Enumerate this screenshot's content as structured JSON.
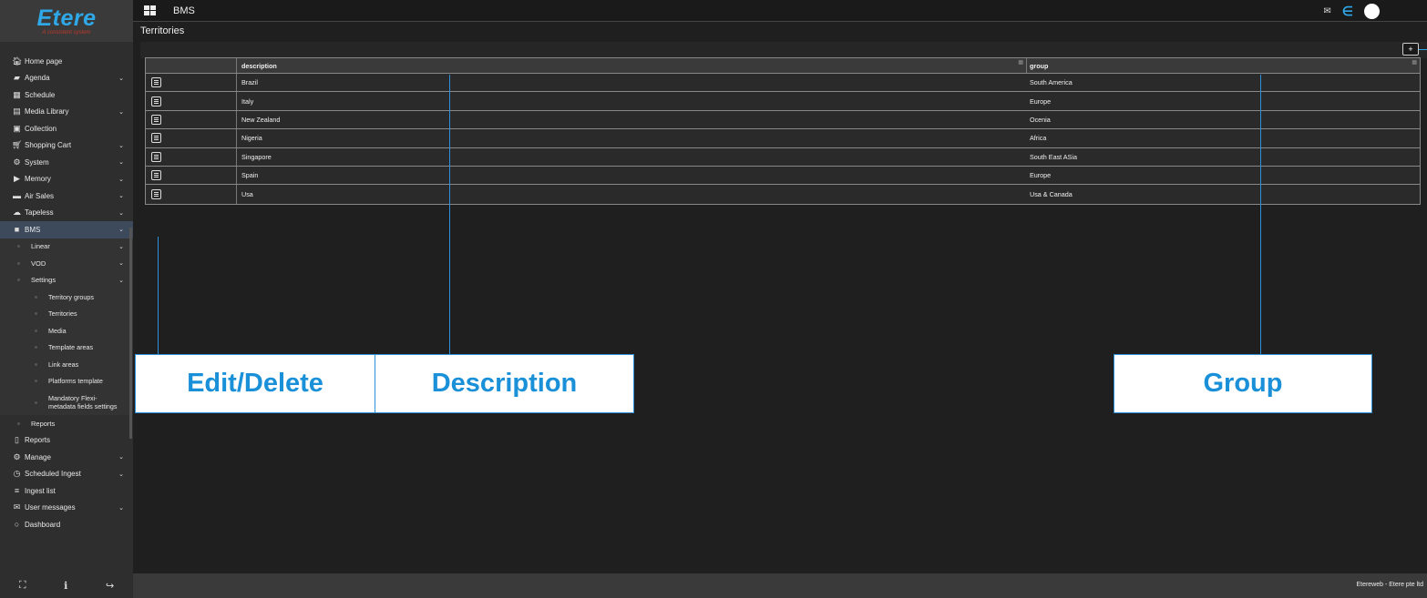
{
  "logo": {
    "brand": "Etere",
    "tagline": "A consistent system"
  },
  "topbar": {
    "app_title": "BMS"
  },
  "page": {
    "title": "Territories",
    "add_label": "+"
  },
  "sidebar": {
    "items": [
      {
        "label": "Home page",
        "icon": "🏠︎",
        "chevron": false
      },
      {
        "label": "Agenda",
        "icon": "▰",
        "chevron": true
      },
      {
        "label": "Schedule",
        "icon": "▦",
        "chevron": false
      },
      {
        "label": "Media Library",
        "icon": "▤",
        "chevron": true
      },
      {
        "label": "Collection",
        "icon": "▣",
        "chevron": false
      },
      {
        "label": "Shopping Cart",
        "icon": "🛒︎",
        "chevron": true
      },
      {
        "label": "System",
        "icon": "⚙",
        "chevron": true
      },
      {
        "label": "Memory",
        "icon": "▶",
        "chevron": true
      },
      {
        "label": "Air Sales",
        "icon": "▬",
        "chevron": true
      },
      {
        "label": "Tapeless",
        "icon": "☁",
        "chevron": true
      },
      {
        "label": "BMS",
        "icon": "■",
        "chevron": true
      },
      {
        "label": "Linear",
        "chevron": true
      },
      {
        "label": "VOD",
        "chevron": true
      },
      {
        "label": "Settings",
        "chevron": true
      },
      {
        "label": "Territory groups"
      },
      {
        "label": "Territories"
      },
      {
        "label": "Media"
      },
      {
        "label": "Template areas"
      },
      {
        "label": "Link areas"
      },
      {
        "label": "Platforms template"
      },
      {
        "label": "Mandatory Flexi-metadata fields settings"
      },
      {
        "label": "Reports"
      },
      {
        "label": "Reports",
        "icon": "▯",
        "chevron": false
      },
      {
        "label": "Manage",
        "icon": "⚙",
        "chevron": true
      },
      {
        "label": "Scheduled Ingest",
        "icon": "◷",
        "chevron": true
      },
      {
        "label": "Ingest list",
        "icon": "≡",
        "chevron": false
      },
      {
        "label": "User messages",
        "icon": "✉",
        "chevron": true
      },
      {
        "label": "Dashboard",
        "icon": "○",
        "chevron": false
      }
    ],
    "footer_icons": [
      "⛶",
      "ℹ",
      "↪"
    ]
  },
  "table": {
    "headers": {
      "edit": "",
      "description": "description",
      "group": "group"
    },
    "rows": [
      {
        "description": "Brazil",
        "group": "South America"
      },
      {
        "description": "Italy",
        "group": "Europe"
      },
      {
        "description": "New Zealand",
        "group": "Ocenia"
      },
      {
        "description": "Nigeria",
        "group": "Africa"
      },
      {
        "description": "Singapore",
        "group": "South East ASia"
      },
      {
        "description": "Spain",
        "group": "Europe"
      },
      {
        "description": "Usa",
        "group": "Usa & Canada"
      }
    ]
  },
  "callouts": {
    "edit": "Edit/Delete",
    "description": "Description",
    "group": "Group"
  },
  "footer": {
    "text": "Etereweb - Etere pte ltd"
  },
  "colors": {
    "accent": "#2fa8e8",
    "callout_text": "#1a90d8",
    "active_nav": "#3c4a5c"
  }
}
